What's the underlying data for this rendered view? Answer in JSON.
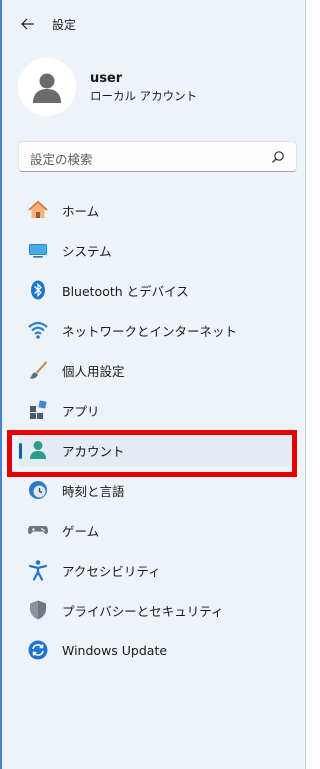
{
  "window": {
    "title": "設定"
  },
  "profile": {
    "name": "user",
    "account_type": "ローカル アカウント"
  },
  "search": {
    "placeholder": "設定の検索"
  },
  "nav": {
    "items": [
      {
        "label": "ホーム",
        "icon": "home-icon"
      },
      {
        "label": "システム",
        "icon": "system-icon"
      },
      {
        "label": "Bluetooth とデバイス",
        "icon": "bluetooth-icon"
      },
      {
        "label": "ネットワークとインターネット",
        "icon": "wifi-icon"
      },
      {
        "label": "個人用設定",
        "icon": "brush-icon"
      },
      {
        "label": "アプリ",
        "icon": "apps-icon"
      },
      {
        "label": "アカウント",
        "icon": "account-icon",
        "selected": true
      },
      {
        "label": "時刻と言語",
        "icon": "time-language-icon"
      },
      {
        "label": "ゲーム",
        "icon": "gamepad-icon"
      },
      {
        "label": "アクセシビリティ",
        "icon": "accessibility-icon"
      },
      {
        "label": "プライバシーとセキュリティ",
        "icon": "shield-icon"
      },
      {
        "label": "Windows Update",
        "icon": "update-icon"
      }
    ]
  },
  "colors": {
    "accent": "#0067c0",
    "highlight_box": "#e60000",
    "background": "#eef3f9"
  }
}
